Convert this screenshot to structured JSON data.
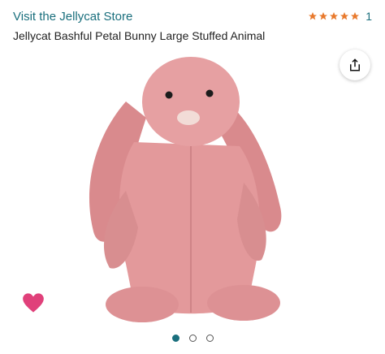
{
  "header": {
    "store_link": "Visit the Jellycat Store",
    "rating_count": "1",
    "stars": 5
  },
  "product": {
    "title": "Jellycat Bashful Petal Bunny Large Stuffed Animal"
  },
  "carousel": {
    "total_images": 3,
    "active_index": 0
  },
  "icons": {
    "share": "share-icon",
    "heart": "heart-icon"
  },
  "colors": {
    "link": "#1a6f7d",
    "star": "#e8792c",
    "heart": "#e0407a",
    "bunny": "#e3999b"
  }
}
